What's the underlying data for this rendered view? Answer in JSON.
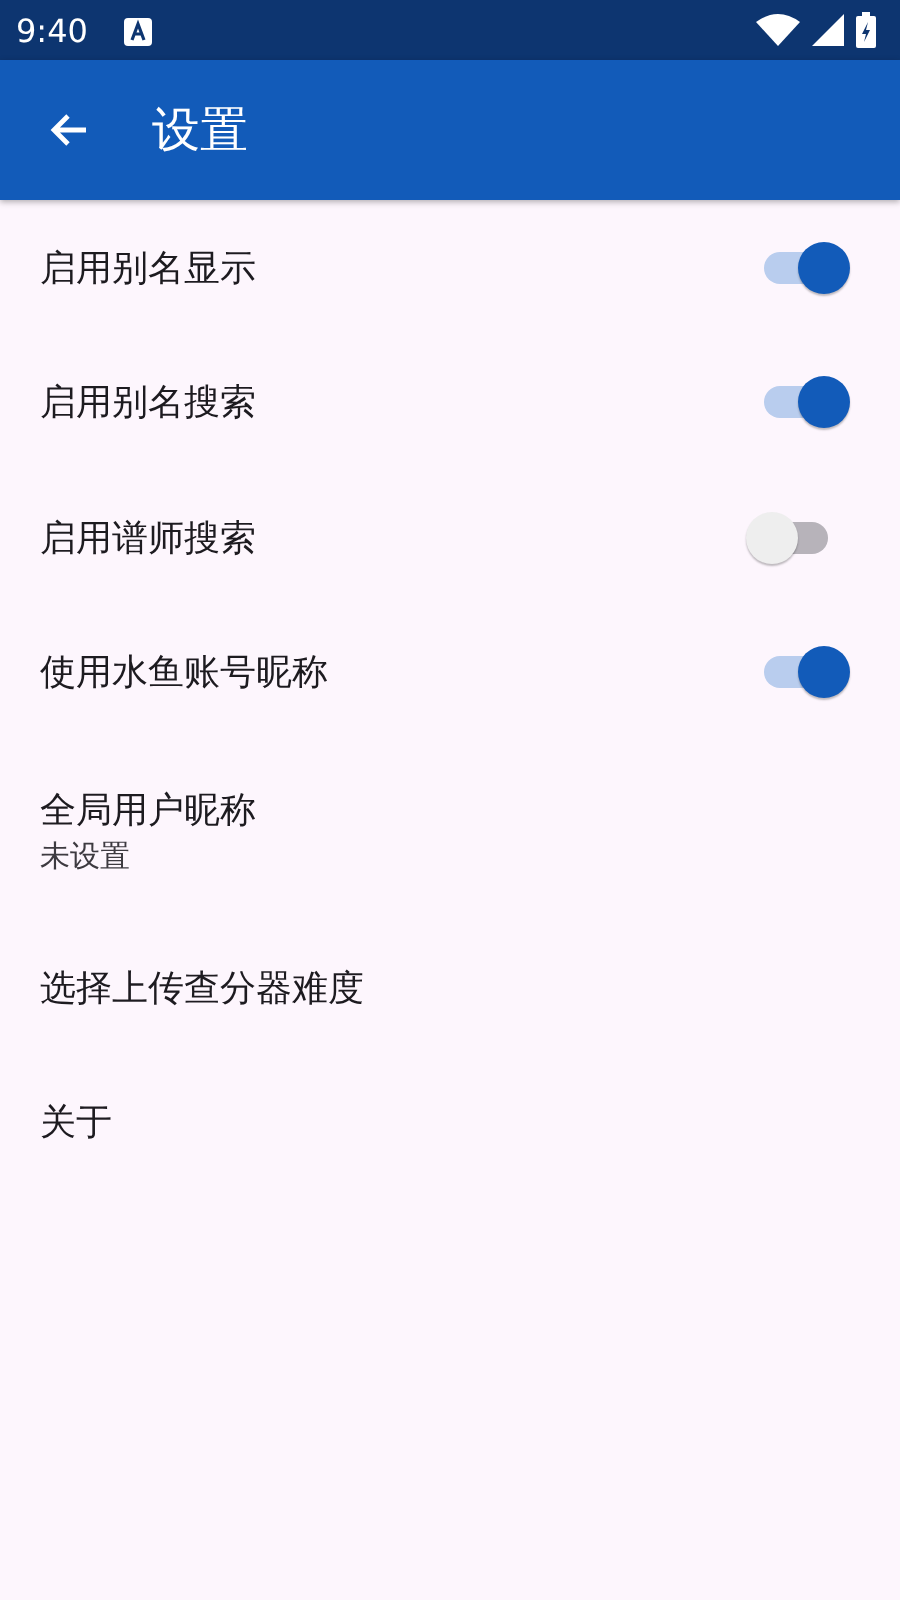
{
  "status_bar": {
    "time": "9:40"
  },
  "app_bar": {
    "title": "设置"
  },
  "settings": [
    {
      "kind": "toggle",
      "label": "启用别名显示",
      "on": true
    },
    {
      "kind": "toggle",
      "label": "启用别名搜索",
      "on": true
    },
    {
      "kind": "toggle",
      "label": "启用谱师搜索",
      "on": false
    },
    {
      "kind": "toggle",
      "label": "使用水鱼账号昵称",
      "on": true
    },
    {
      "kind": "text",
      "label": "全局用户昵称",
      "summary": "未设置"
    },
    {
      "kind": "text",
      "label": "选择上传查分器难度"
    },
    {
      "kind": "text",
      "label": "关于"
    }
  ]
}
